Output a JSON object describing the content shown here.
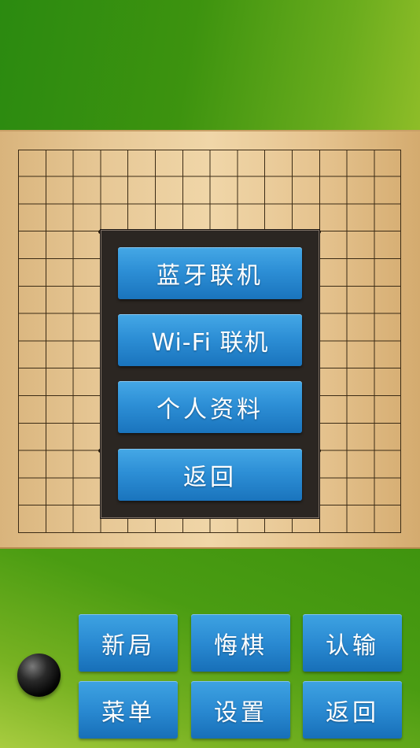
{
  "menu": {
    "bluetooth_label": "蓝牙联机",
    "wifi_label": "Wi-Fi 联机",
    "profile_label": "个人资料",
    "back_label": "返回"
  },
  "controls": {
    "new_game_label": "新局",
    "undo_label": "悔棋",
    "resign_label": "认输",
    "menu_label": "菜单",
    "settings_label": "设置",
    "back_label": "返回"
  },
  "current_stone": "black-stone-icon",
  "colors": {
    "button_blue": "#2a8ad2",
    "background_green": "#3f950f",
    "board_wood": "#e7c896",
    "dialog_dark": "#2b2622"
  }
}
